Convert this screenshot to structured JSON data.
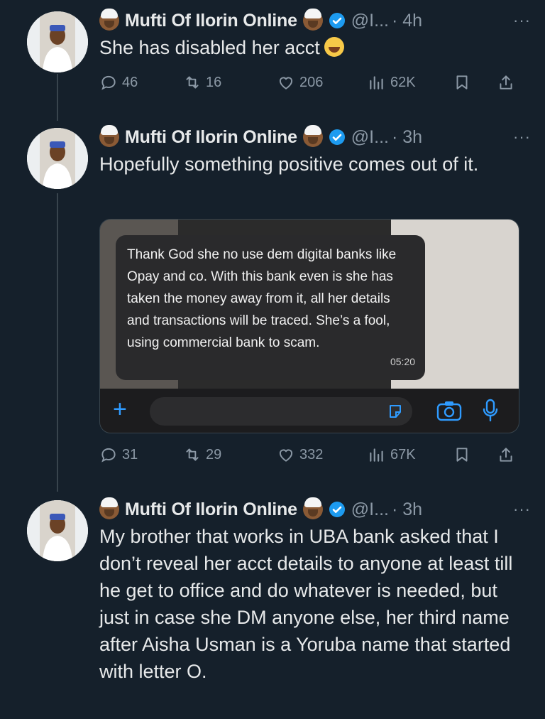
{
  "tweets": [
    {
      "name": "Mufti Of Ilorin Online",
      "handle": "@I...",
      "time": "· 4h",
      "more": "···",
      "text": "She has disabled her acct",
      "replies": "46",
      "retweets": "16",
      "likes": "206",
      "views": "62K"
    },
    {
      "name": "Mufti Of Ilorin Online",
      "handle": "@I...",
      "time": "· 3h",
      "more": "···",
      "text": "Hopefully something positive comes out of it.",
      "replies": "31",
      "retweets": "29",
      "likes": "332",
      "views": "67K",
      "media": {
        "message": "Thank God she no use dem digital banks like Opay and co. With this bank even is she has taken the money away from it, all her details and transactions will be traced. She’s a fool, using commercial bank to scam.",
        "time": "05:20",
        "plus": "+"
      }
    },
    {
      "name": "Mufti Of Ilorin Online",
      "handle": "@I...",
      "time": "· 3h",
      "more": "···",
      "text": "My brother that works in UBA bank asked that I don’t reveal her acct details to anyone at least till he get to office and do whatever is needed, but just in case she DM anyone else, her third name after Aisha Usman is a Yoruba name that started with letter O."
    }
  ],
  "colors": {
    "background": "#15202b",
    "text": "#e7e9ea",
    "muted": "#8b98a5",
    "verified": "#1d9bf0",
    "ios_blue": "#2f9bff"
  },
  "icons": [
    "reply-icon",
    "retweet-icon",
    "like-icon",
    "views-icon",
    "bookmark-icon",
    "share-icon",
    "verified-icon",
    "plus-icon",
    "sticker-icon",
    "camera-icon",
    "microphone-icon"
  ]
}
